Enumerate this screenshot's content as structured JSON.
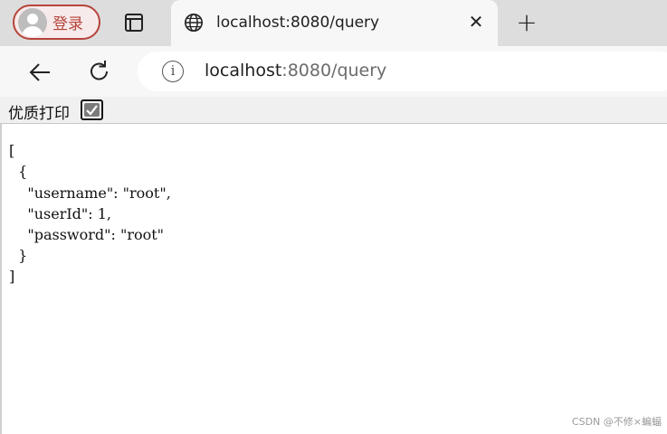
{
  "profile": {
    "label": "登录"
  },
  "tab": {
    "title": "localhost:8080/query",
    "close_glyph": "✕"
  },
  "new_tab_glyph": "+",
  "address": {
    "host": "localhost",
    "rest": ":8080/query",
    "info_glyph": "i"
  },
  "viewer": {
    "pretty_print_label": "优质打印",
    "pretty_print_checked": true
  },
  "json_lines": [
    "[",
    "  {",
    "    \"username\": \"root\",",
    "    \"userId\": 1,",
    "    \"password\": \"root\"",
    "  }",
    "]"
  ],
  "watermark": "CSDN @不修×蝙蝠",
  "icons": {
    "tab_actions": "tab-actions-icon",
    "globe": "globe-icon",
    "back": "back-arrow-icon",
    "reload": "reload-icon",
    "info": "info-icon",
    "checkbox": "checkbox-checked-icon"
  },
  "colors": {
    "profile_accent": "#b5443a"
  }
}
